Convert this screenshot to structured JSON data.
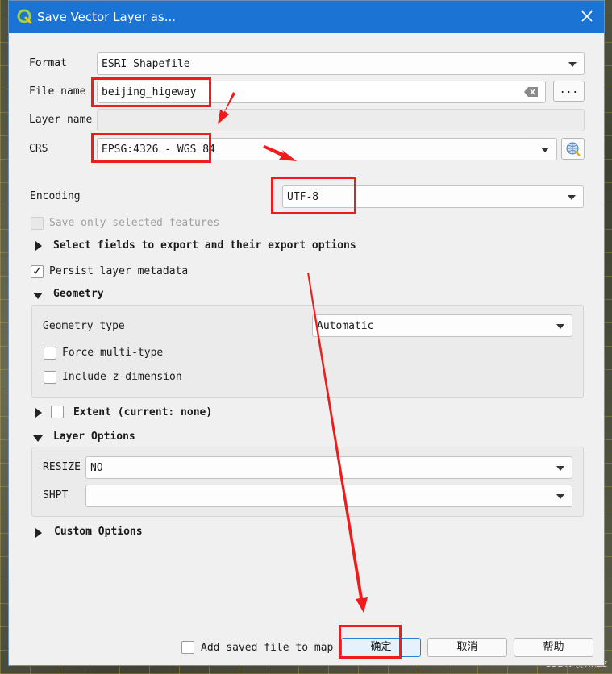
{
  "window": {
    "title": "Save Vector Layer as..."
  },
  "form": {
    "format_label": "Format",
    "format_value": "ESRI Shapefile",
    "filename_label": "File name",
    "filename_value": "beijing_higeway",
    "browse_label": "...",
    "layername_label": "Layer name",
    "layername_value": "",
    "crs_label": "CRS",
    "crs_value": "EPSG:4326 - WGS 84",
    "encoding_label": "Encoding",
    "encoding_value": "UTF-8",
    "save_selected_label": "Save only selected features",
    "select_fields_label": "Select fields to export and their export options",
    "persist_metadata_label": "Persist layer metadata"
  },
  "geometry": {
    "header": "Geometry",
    "type_label": "Geometry type",
    "type_value": "Automatic",
    "force_multi_label": "Force multi-type",
    "include_z_label": "Include z-dimension"
  },
  "extent": {
    "header": "Extent (current: none)"
  },
  "layer_options": {
    "header": "Layer Options",
    "resize_label": "RESIZE",
    "resize_value": "NO",
    "shpt_label": "SHPT",
    "shpt_value": ""
  },
  "custom_options": {
    "header": "Custom Options"
  },
  "footer": {
    "add_to_map_label": "Add saved file to map",
    "ok_label": "确定",
    "cancel_label": "取消",
    "help_label": "帮助"
  },
  "watermark": "CSDN @hhzz",
  "colors": {
    "titlebar": "#1b73d3",
    "annotation_red": "#ee1c1c",
    "ok_button_bg": "#e5f1fb",
    "ok_button_border": "#2a7fd4"
  },
  "icons": {
    "app": "qgis-logo-icon",
    "close": "close-icon",
    "clear": "clear-text-icon",
    "crs": "crs-globe-icon"
  }
}
